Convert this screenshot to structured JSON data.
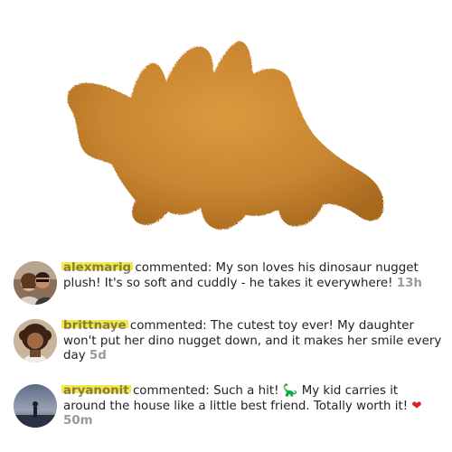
{
  "hero": {
    "image": "dinosaur-nugget-plush-photo"
  },
  "comments": [
    {
      "username": "alexmarig",
      "verb": "commented:",
      "text": "My son loves his dinosaur nugget plush! It's so soft and cuddly - he takes it everywhere!",
      "time": "13h",
      "avatar": "couple-selfie-avatar"
    },
    {
      "username": "brittnaye",
      "verb": "commented:",
      "text": "The cutest toy ever! My daughter won't put her dino nugget down, and it makes her smile every day",
      "time": "5d",
      "avatar": "woman-curly-hair-avatar"
    },
    {
      "username": "aryanonit",
      "verb": "commented:",
      "text": "Such a hit!",
      "emoji1": "🦕",
      "text2": "My kid carries it around the house like a little best friend. Totally worth it!",
      "emoji2": "❤",
      "time": "50m",
      "avatar": "silhouette-sky-avatar"
    }
  ],
  "colors": {
    "highlight": "#f5e64a",
    "nugget": "#c9862f",
    "heart": "#d8232a",
    "time": "#9a9a9a"
  }
}
